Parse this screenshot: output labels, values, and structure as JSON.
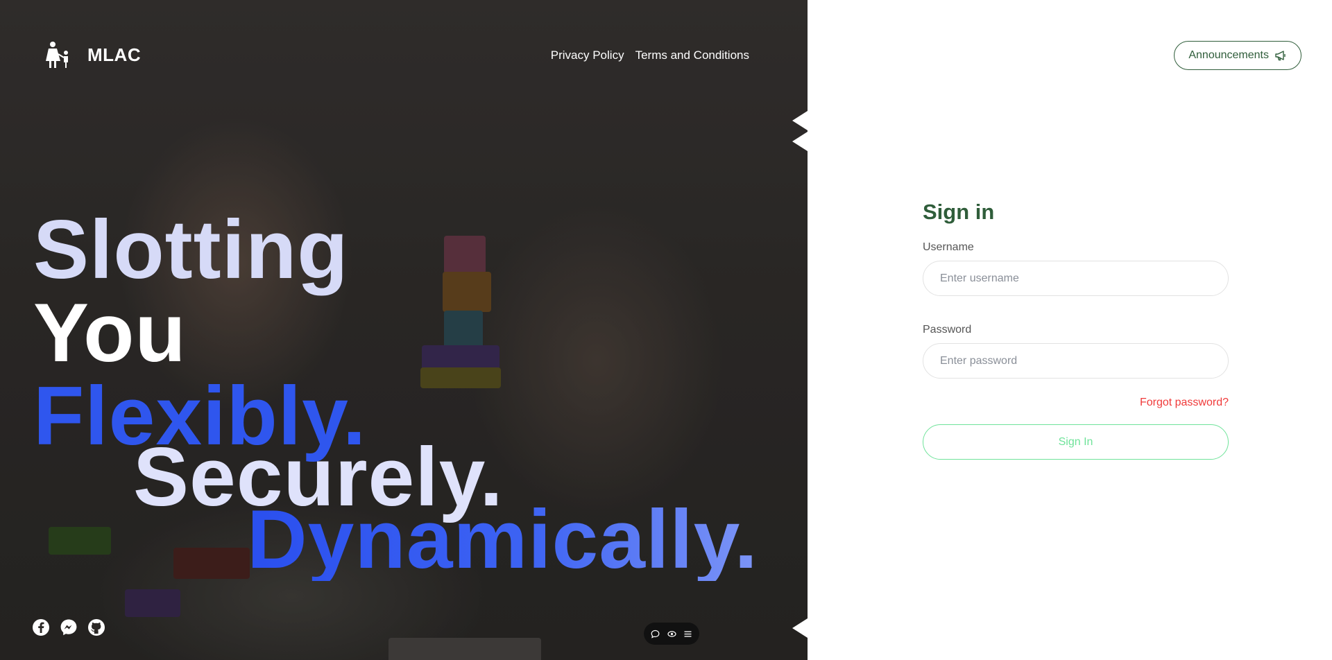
{
  "brand": {
    "name": "MLAC",
    "logo_icon": "mother-child-icon"
  },
  "nav": {
    "links": [
      "Privacy Policy",
      "Terms and Conditions"
    ]
  },
  "hero": {
    "lines": [
      "Slotting",
      "You",
      "Flexibly.",
      "Securely.",
      "Dynamically."
    ]
  },
  "social": {
    "icons": [
      "facebook-icon",
      "messenger-icon",
      "github-icon"
    ]
  },
  "widget": {
    "icons": [
      "chat-icon",
      "eye-icon",
      "menu-icon"
    ]
  },
  "announcements": {
    "label": "Announcements",
    "icon": "megaphone-icon"
  },
  "signin": {
    "title": "Sign in",
    "username_label": "Username",
    "username_placeholder": "Enter username",
    "password_label": "Password",
    "password_placeholder": "Enter password",
    "forgot_label": "Forgot password?",
    "button_label": "Sign In"
  },
  "colors": {
    "brand_green": "#2f5d3a",
    "accent_blue": "#2f56ee",
    "button_green": "#6fe39a",
    "forgot_red": "#f03a3a"
  }
}
